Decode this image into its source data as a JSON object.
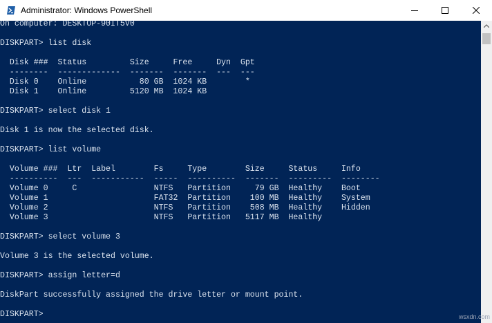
{
  "window": {
    "title": "Administrator: Windows PowerShell",
    "icon": "powershell-icon",
    "controls": [
      "minimize-icon",
      "maximize-icon",
      "close-icon"
    ]
  },
  "colors": {
    "console_background": "#012456",
    "console_text": "#dbe3ee",
    "titlebar_background": "#ffffff",
    "scrollbar_background": "#f0f0f0"
  },
  "console": {
    "lines": [
      "On computer: DESKTOP-90IT5V0",
      "",
      "DISKPART> list disk",
      "",
      "  Disk ###  Status         Size     Free     Dyn  Gpt",
      "  --------  -------------  -------  -------  ---  ---",
      "  Disk 0    Online           80 GB  1024 KB        *",
      "  Disk 1    Online         5120 MB  1024 KB",
      "",
      "DISKPART> select disk 1",
      "",
      "Disk 1 is now the selected disk.",
      "",
      "DISKPART> list volume",
      "",
      "  Volume ###  Ltr  Label        Fs     Type        Size     Status     Info",
      "  ----------  ---  -----------  -----  ----------  -------  ---------  --------",
      "  Volume 0     C                NTFS   Partition     79 GB  Healthy    Boot",
      "  Volume 1                      FAT32  Partition    100 MB  Healthy    System",
      "  Volume 2                      NTFS   Partition    508 MB  Healthy    Hidden",
      "  Volume 3                      NTFS   Partition   5117 MB  Healthy",
      "",
      "DISKPART> select volume 3",
      "",
      "Volume 3 is the selected volume.",
      "",
      "DISKPART> assign letter=d",
      "",
      "DiskPart successfully assigned the drive letter or mount point.",
      "",
      "DISKPART> "
    ]
  },
  "watermark": "wsxdn.com"
}
